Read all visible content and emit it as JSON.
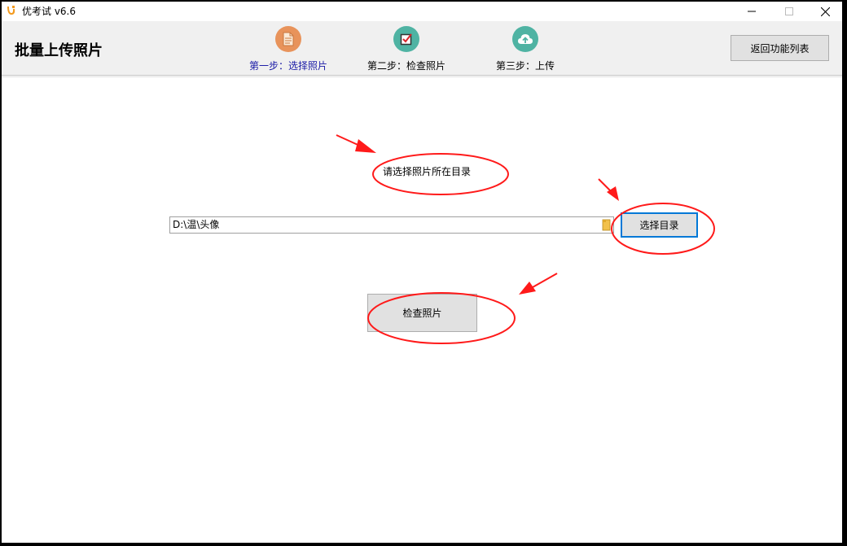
{
  "window": {
    "title": "优考试 v6.6"
  },
  "header": {
    "page_title": "批量上传照片",
    "back_button": "返回功能列表"
  },
  "steps": [
    {
      "label": "第一步：选择照片",
      "icon": "document-icon",
      "color": "#e8935b",
      "label_color": "#1a1aa6"
    },
    {
      "label": "第二步：检查照片",
      "icon": "checkbox-icon",
      "color": "#4fb3a3",
      "label_color": "#000000"
    },
    {
      "label": "第三步：上传",
      "icon": "cloud-upload-icon",
      "color": "#4fb3a3",
      "label_color": "#000000"
    }
  ],
  "main": {
    "prompt": "请选择照片所在目录",
    "path_value": "D:\\温\\头像",
    "select_dir_button": "选择目录",
    "check_photos_button": "检查照片"
  },
  "colors": {
    "annotation_red": "#ff1a1a",
    "focus_blue": "#0078d7"
  }
}
